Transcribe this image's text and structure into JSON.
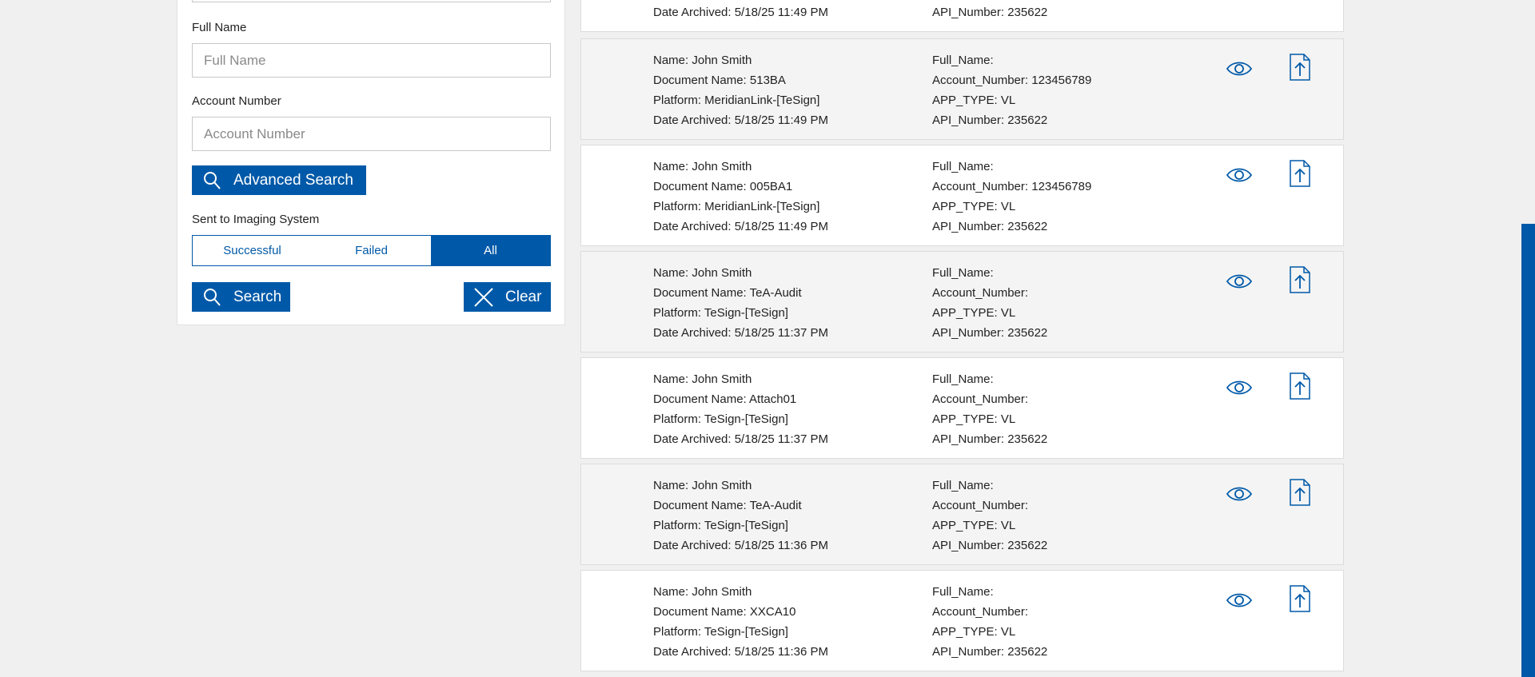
{
  "search": {
    "full_name_label": "Full Name",
    "full_name_placeholder": "Full Name",
    "account_number_label": "Account Number",
    "account_number_placeholder": "Account Number",
    "advanced_search_label": "Advanced Search",
    "sent_to_imaging_label": "Sent to Imaging System",
    "filter_options": [
      "Successful",
      "Failed",
      "All"
    ],
    "selected_filter": "All",
    "search_label": "Search",
    "clear_label": "Clear"
  },
  "results": {
    "partial_top": {
      "date_archived": "Date Archived: 5/18/25 11:49 PM",
      "api_number": "API_Number: 235622"
    },
    "records": [
      {
        "name": "Name: John Smith",
        "document_name": "Document Name: 513BA",
        "platform": "Platform: MeridianLink-[TeSign]",
        "date_archived": "Date Archived: 5/18/25 11:49 PM",
        "full_name": "Full_Name:",
        "account_number": "Account_Number: 123456789",
        "app_type": "APP_TYPE: VL",
        "api_number": "API_Number: 235622"
      },
      {
        "name": "Name: John Smith",
        "document_name": "Document Name: 005BA1",
        "platform": "Platform: MeridianLink-[TeSign]",
        "date_archived": "Date Archived: 5/18/25 11:49 PM",
        "full_name": "Full_Name:",
        "account_number": "Account_Number: 123456789",
        "app_type": "APP_TYPE: VL",
        "api_number": "API_Number: 235622"
      },
      {
        "name": "Name: John Smith",
        "document_name": "Document Name: TeA-Audit",
        "platform": "Platform: TeSign-[TeSign]",
        "date_archived": "Date Archived: 5/18/25 11:37 PM",
        "full_name": "Full_Name:",
        "account_number": "Account_Number:",
        "app_type": "APP_TYPE: VL",
        "api_number": "API_Number: 235622"
      },
      {
        "name": "Name: John Smith",
        "document_name": "Document Name: Attach01",
        "platform": "Platform: TeSign-[TeSign]",
        "date_archived": "Date Archived: 5/18/25 11:37 PM",
        "full_name": "Full_Name:",
        "account_number": "Account_Number:",
        "app_type": "APP_TYPE: VL",
        "api_number": "API_Number: 235622"
      },
      {
        "name": "Name: John Smith",
        "document_name": "Document Name: TeA-Audit",
        "platform": "Platform: TeSign-[TeSign]",
        "date_archived": "Date Archived: 5/18/25 11:36 PM",
        "full_name": "Full_Name:",
        "account_number": "Account_Number:",
        "app_type": "APP_TYPE: VL",
        "api_number": "API_Number: 235622"
      },
      {
        "name": "Name: John Smith",
        "document_name": "Document Name: XXCA10",
        "platform": "Platform: TeSign-[TeSign]",
        "date_archived": "Date Archived: 5/18/25 11:36 PM",
        "full_name": "Full_Name:",
        "account_number": "Account_Number:",
        "app_type": "APP_TYPE: VL",
        "api_number": "API_Number: 235622"
      }
    ]
  },
  "icons": {
    "search": "magnifier-icon",
    "clear": "x-icon",
    "view": "eye-icon",
    "upload": "file-upload-icon"
  },
  "colors": {
    "accent": "#0059a8",
    "page_background": "#f0f0f0",
    "card_alt": "#f4f4f4"
  }
}
